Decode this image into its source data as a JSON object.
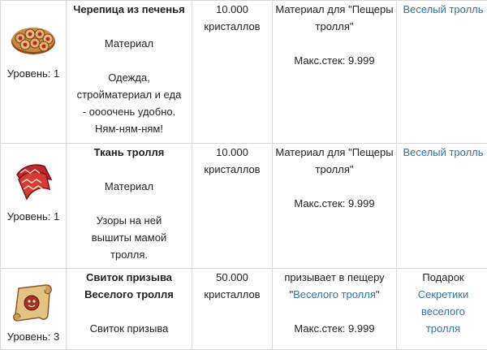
{
  "rows": [
    {
      "icon": "cookie-tiles-icon",
      "level": "Уровень: 1",
      "name_lines": [
        "Черепица из печенья"
      ],
      "type": "Материал",
      "desc_lines": [
        "Одежда,",
        "стройматериал и еда",
        "- оооочень удобно.",
        "Ням-ням-ням!"
      ],
      "price_lines": [
        "10.000",
        "кристаллов"
      ],
      "use_lines": [
        "Материал для \"Пещеры",
        "тролля\""
      ],
      "stack": "Макс.стек: 9.999",
      "source": "Веселый тролль"
    },
    {
      "icon": "troll-cloth-icon",
      "level": "Уровень: 1",
      "name_lines": [
        "Ткань тролля"
      ],
      "type": "Материал",
      "desc_lines": [
        "Узоры на ней",
        "вышиты мамой",
        "тролля."
      ],
      "price_lines": [
        "10.000",
        "кристаллов"
      ],
      "use_lines": [
        "Материал для \"Пещеры",
        "тролля\""
      ],
      "stack": "Макс.стек: 9.999",
      "source": "Веселый тролль"
    },
    {
      "icon": "summon-scroll-icon",
      "level": "Уровень: 3",
      "name_lines": [
        "Свиток призыва",
        "Веселого тролля"
      ],
      "type": "Свиток призыва",
      "price_lines": [
        "50.000",
        "кристаллов"
      ],
      "use_text": "призывает в пещеру",
      "use_link_pre": "\"",
      "use_link": "Веселого тролля",
      "use_link_post": "\"",
      "stack": "Макс.стек: 9.999",
      "source_label": "Подарок",
      "source_link_lines": [
        "Секретики",
        "веселого",
        "тролля"
      ]
    }
  ],
  "colors": {
    "link": "#3a6ea5",
    "border": "#d8d8d8",
    "text": "#222222"
  }
}
